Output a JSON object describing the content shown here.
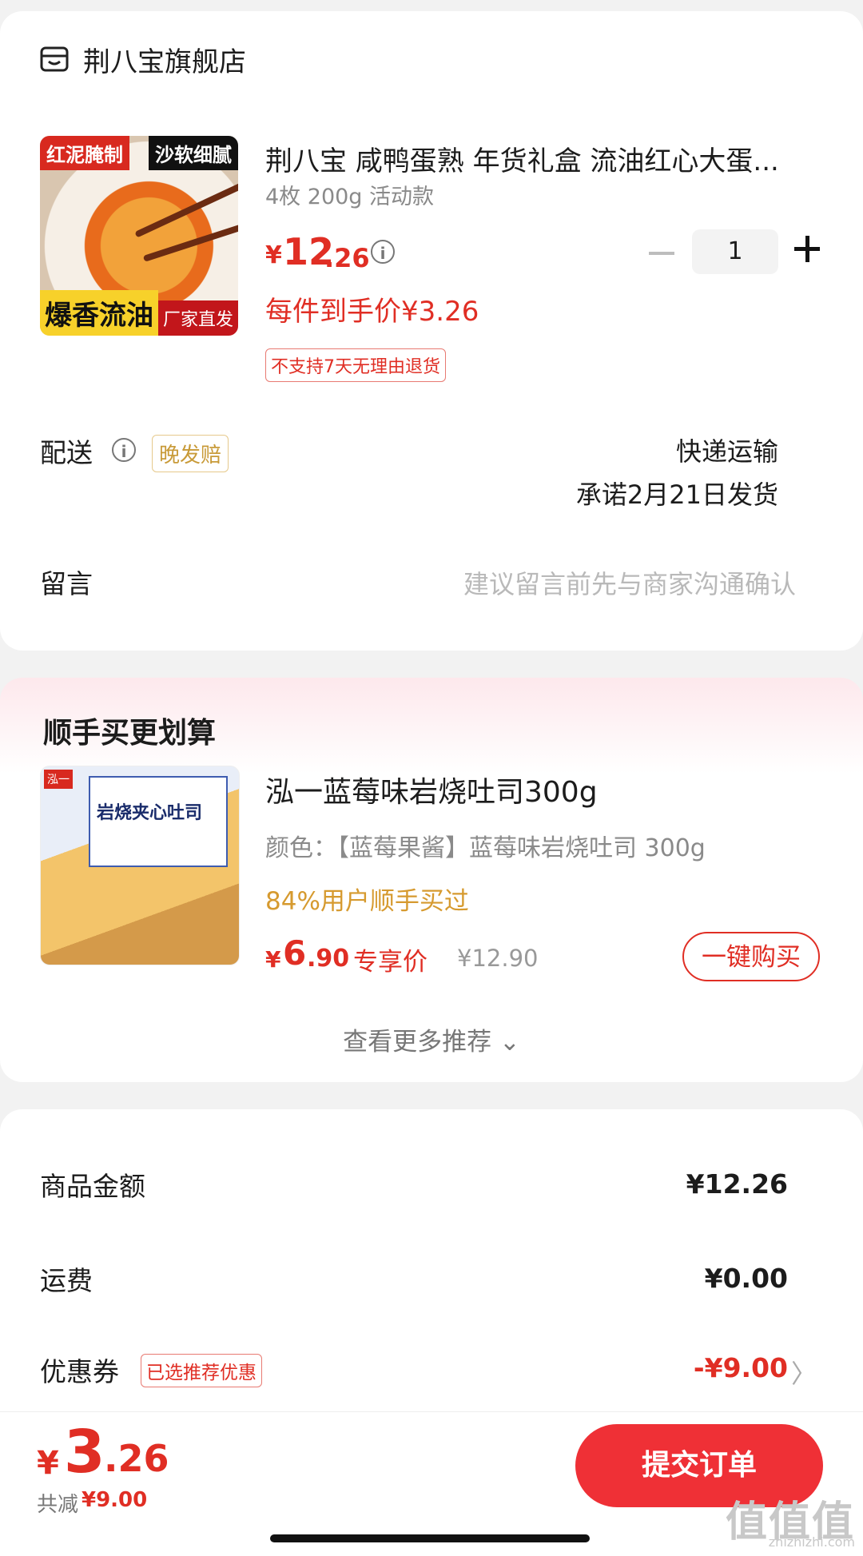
{
  "store": {
    "name": "荆八宝旗舰店",
    "icon": "store-icon"
  },
  "product": {
    "title": "荆八宝 咸鸭蛋熟 年货礼盒 流油红心大蛋...",
    "spec": "4枚 200g 活动款",
    "price_symbol": "¥",
    "price_int": "12",
    "price_dec": ".26",
    "unit_price": "每件到手价¥3.26",
    "return_policy": "不支持7天无理由退货",
    "quantity": "1",
    "image_tags": {
      "top_left": "红泥腌制",
      "top_right": "沙软细腻",
      "bottom_left": "爆香流油",
      "bottom_right": "厂家直发"
    }
  },
  "delivery": {
    "label": "配送",
    "late_tag": "晚发赔",
    "method": "快递运输",
    "promise": "承诺2月21日发货"
  },
  "message": {
    "label": "留言",
    "placeholder": "建议留言前先与商家沟通确认"
  },
  "recommendation": {
    "heading": "顺手买更划算",
    "title": "泓一蓝莓味岩烧吐司300g",
    "spec": "颜色：【蓝莓果酱】蓝莓味岩烧吐司 300g",
    "social_proof": "84%用户顺手买过",
    "price_symbol": "¥",
    "price_int": "6",
    "price_dec": ".90",
    "exclusive_label": "专享价",
    "original_price": "¥12.90",
    "buy_button": "一键购买",
    "see_more": "查看更多推荐 ⌄",
    "image_text": {
      "logo": "泓一",
      "box": "岩烧夹心吐司"
    }
  },
  "summary": {
    "goods_amount_label": "商品金额",
    "goods_amount_value": "¥12.26",
    "shipping_label": "运费",
    "shipping_value": "¥0.00",
    "coupon_label": "优惠券",
    "coupon_tag": "已选推荐优惠",
    "coupon_value": "-¥9.00"
  },
  "footer": {
    "total_symbol": "¥",
    "total_int": "3",
    "total_dec": ".26",
    "saved_label": "共减",
    "saved_value": "¥9.00",
    "submit_button": "提交订单"
  },
  "watermark": {
    "main": "值值值",
    "sub": "zhizhizhi.com"
  },
  "colors": {
    "accent": "#e02e24",
    "button": "#ef3036",
    "tag_gold": "#c89a38",
    "social_gold": "#d69a2f"
  }
}
